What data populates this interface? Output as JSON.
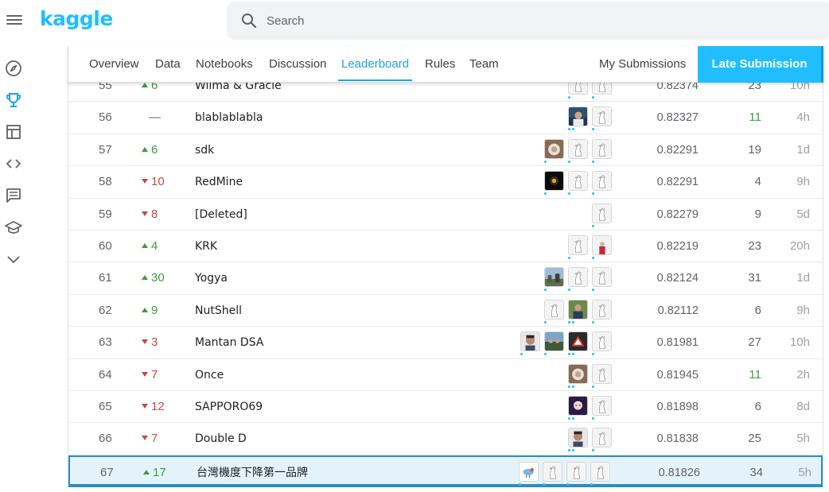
{
  "app": {
    "logo": "kaggle"
  },
  "search": {
    "placeholder": "Search"
  },
  "sidenav": [
    {
      "name": "compass-icon"
    },
    {
      "name": "trophy-icon"
    },
    {
      "name": "table-icon"
    },
    {
      "name": "code-icon"
    },
    {
      "name": "comment-icon"
    },
    {
      "name": "graduation-cap-icon"
    },
    {
      "name": "chevron-down-icon"
    }
  ],
  "tabs": {
    "overview": "Overview",
    "data": "Data",
    "notebooks": "Notebooks",
    "discussion": "Discussion",
    "leaderboard": "Leaderboard",
    "rules": "Rules",
    "team": "Team",
    "my_submissions": "My Submissions",
    "late_submission": "Late Submission",
    "active": "leaderboard"
  },
  "colors": {
    "accent": "#20beff",
    "up": "#3c9c3a",
    "down": "#c5493f",
    "highlight": "#e4f3fa"
  },
  "leaderboard": [
    {
      "rank": "55",
      "delta": "6",
      "dir": "up",
      "team": "Wilma & Gracie",
      "score": "0.82374",
      "entries": "23",
      "last": "10h",
      "avatars": [
        "default",
        "default"
      ]
    },
    {
      "rank": "56",
      "delta": "—",
      "dir": "same",
      "team": "blablablabla",
      "score": "0.82327",
      "entries": "11",
      "last": "4h",
      "avatars": [
        "photo-blue",
        "default"
      ]
    },
    {
      "rank": "57",
      "delta": "6",
      "dir": "up",
      "team": "sdk",
      "score": "0.82291",
      "entries": "19",
      "last": "1d",
      "avatars": [
        "photo-brown",
        "default",
        "default"
      ]
    },
    {
      "rank": "58",
      "delta": "10",
      "dir": "down",
      "team": "RedMine",
      "score": "0.82291",
      "entries": "4",
      "last": "9h",
      "avatars": [
        "photo-dark",
        "default",
        "default"
      ]
    },
    {
      "rank": "59",
      "delta": "8",
      "dir": "down",
      "team": "[Deleted]",
      "score": "0.82279",
      "entries": "9",
      "last": "5d",
      "avatars": [
        "default"
      ]
    },
    {
      "rank": "60",
      "delta": "4",
      "dir": "up",
      "team": "KRK",
      "score": "0.82219",
      "entries": "23",
      "last": "20h",
      "avatars": [
        "default",
        "photo-red"
      ]
    },
    {
      "rank": "61",
      "delta": "30",
      "dir": "up",
      "team": "Yogya",
      "score": "0.82124",
      "entries": "31",
      "last": "1d",
      "avatars": [
        "photo-sky",
        "default",
        "default"
      ]
    },
    {
      "rank": "62",
      "delta": "9",
      "dir": "up",
      "team": "NutShell",
      "score": "0.82112",
      "entries": "6",
      "last": "9h",
      "avatars": [
        "default",
        "photo-green",
        "default"
      ]
    },
    {
      "rank": "63",
      "delta": "3",
      "dir": "down",
      "team": "Mantan DSA",
      "score": "0.81981",
      "entries": "27",
      "last": "10h",
      "avatars": [
        "photo-face",
        "photo-group",
        "photo-sign",
        "default"
      ]
    },
    {
      "rank": "64",
      "delta": "7",
      "dir": "down",
      "team": "Once",
      "score": "0.81945",
      "entries": "11",
      "last": "2h",
      "avatars": [
        "photo-brown",
        "default"
      ]
    },
    {
      "rank": "65",
      "delta": "12",
      "dir": "down",
      "team": "SAPPORO69",
      "score": "0.81898",
      "entries": "6",
      "last": "8d",
      "avatars": [
        "photo-anime",
        "default"
      ]
    },
    {
      "rank": "66",
      "delta": "7",
      "dir": "down",
      "team": "Double D",
      "score": "0.81838",
      "entries": "25",
      "last": "5h",
      "avatars": [
        "photo-face",
        "default"
      ]
    },
    {
      "rank": "67",
      "delta": "17",
      "dir": "up",
      "team": "台灣機度下降第一品牌",
      "score": "0.81826",
      "entries": "34",
      "last": "5h",
      "avatars": [
        "photo-bird",
        "default",
        "default",
        "default"
      ],
      "highlight": true
    }
  ]
}
